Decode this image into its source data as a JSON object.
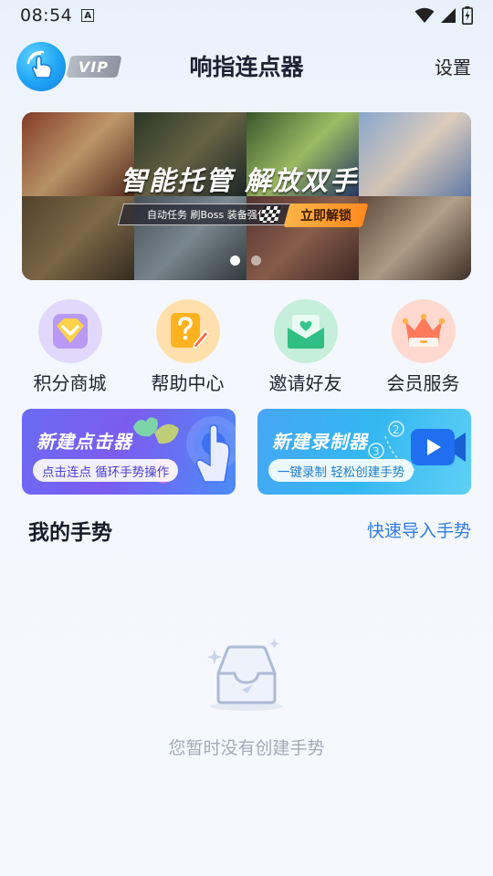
{
  "status_bar": {
    "time": "08:54",
    "notification_glyph": "A"
  },
  "header": {
    "title": "响指连点器",
    "vip_label": "VIP",
    "settings_label": "设置"
  },
  "banner": {
    "headline": "智能托管  解放双手",
    "tagline": "自动任务 刷Boss 装备强化",
    "cta_label": "立即解锁",
    "active_slide": 1,
    "slide_count": 2
  },
  "quick_actions": [
    {
      "label": "积分商城",
      "icon": "diamond-icon",
      "bg": "#e4dbfb"
    },
    {
      "label": "帮助中心",
      "icon": "help-icon",
      "bg": "#ffe2b3"
    },
    {
      "label": "邀请好友",
      "icon": "heart-envelope-icon",
      "bg": "#c8f0de"
    },
    {
      "label": "会员服务",
      "icon": "crown-icon",
      "bg": "#ffdcd3"
    }
  ],
  "cards": {
    "clicker": {
      "title": "新建点击器",
      "subtitle": "点击连点 循环手势操作"
    },
    "recorder": {
      "title": "新建录制器",
      "subtitle": "一键录制 轻松创建手势"
    }
  },
  "gestures": {
    "section_title": "我的手势",
    "import_link": "快速导入手势",
    "empty_text": "您暂时没有创建手势"
  }
}
